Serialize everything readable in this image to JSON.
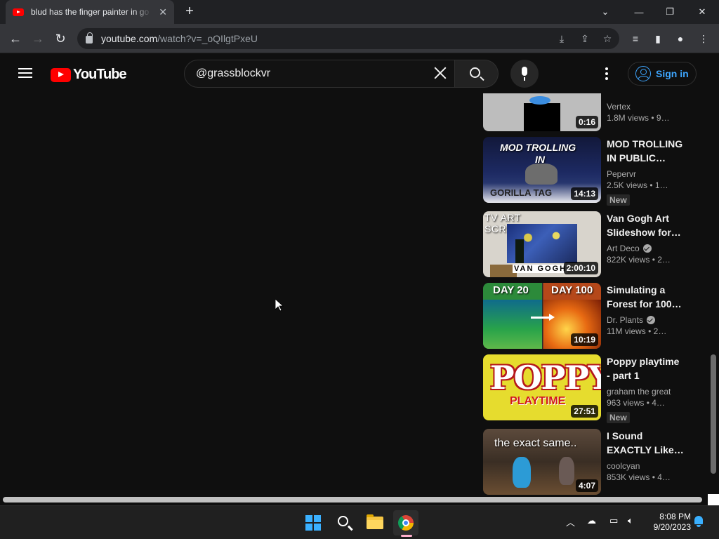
{
  "browser": {
    "tab_title": "blud has the finger painter in go",
    "url_host": "youtube.com",
    "url_path": "/watch?v=_oQIlgtPxeU"
  },
  "youtube": {
    "logo_text": "YouTube",
    "search_query": "@grassblockvr",
    "signin_label": "Sign in"
  },
  "related": [
    {
      "title": "",
      "channel": "Vertex",
      "verified": false,
      "views": "1.8M views",
      "age": "9…",
      "duration": "0:16",
      "badge": "",
      "thumb_text": []
    },
    {
      "title": "MOD TROLLING IN PUBLIC…",
      "channel": "Pepervr",
      "verified": false,
      "views": "2.5K views",
      "age": "1…",
      "duration": "14:13",
      "badge": "New",
      "thumb_text": [
        "MOD TROLLING",
        "IN",
        "GORILLA TAG"
      ]
    },
    {
      "title": "Van Gogh Art Slideshow for…",
      "channel": "Art Deco",
      "verified": true,
      "views": "822K views",
      "age": "2…",
      "duration": "2:00:10",
      "badge": "",
      "thumb_text": [
        "TV ART SCREENSAVER",
        "VAN GOGH"
      ]
    },
    {
      "title": "Simulating a Forest for 100…",
      "channel": "Dr. Plants",
      "verified": true,
      "views": "11M views",
      "age": "2…",
      "duration": "10:19",
      "badge": "",
      "thumb_text": [
        "DAY 20",
        "DAY 100"
      ]
    },
    {
      "title": "Poppy playtime - part 1",
      "channel": "graham the great",
      "verified": false,
      "views": "963 views",
      "age": "4…",
      "duration": "27:51",
      "badge": "New",
      "thumb_text": [
        "POPPY",
        "PLAYTIME"
      ]
    },
    {
      "title": "I Sound EXACTLY Like…",
      "channel": "coolcyan",
      "verified": false,
      "views": "853K views",
      "age": "4…",
      "duration": "4:07",
      "badge": "",
      "thumb_text": [
        "the exact same.."
      ]
    }
  ],
  "taskbar": {
    "time": "8:08 PM",
    "date": "9/20/2023"
  },
  "colors": {
    "background": "#0f0f0f",
    "accent_blue": "#3ea6ff",
    "brand_red": "#ff0000"
  }
}
